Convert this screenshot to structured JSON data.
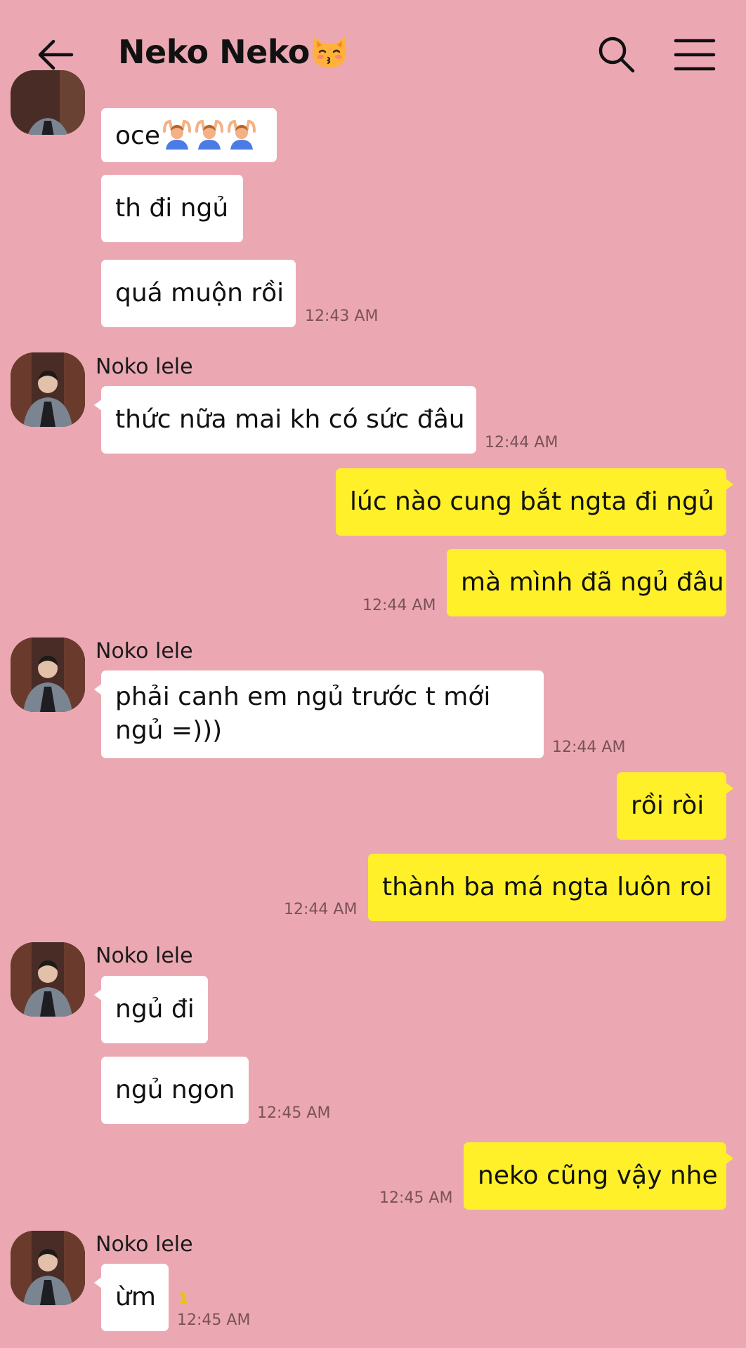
{
  "header": {
    "title": "Neko Neko",
    "title_emoji": "kissing-cat-emoji"
  },
  "contact_name": "Noko lele",
  "messages": [
    {
      "text": "oce",
      "emoji": "person-gesturing-ok x3"
    },
    {
      "text": "th đi ngủ"
    },
    {
      "text": "quá muộn rồi",
      "time": "12:43 AM"
    },
    {
      "text": "thức nữa mai kh có sức đâu",
      "time": "12:44 AM"
    },
    {
      "text": "lúc nào cung bắt ngta đi ngủ"
    },
    {
      "text": "mà mình đã ngủ đâu",
      "time": "12:44 AM"
    },
    {
      "text": "phải canh em ngủ trước t mới ngủ =)))",
      "time": "12:44 AM"
    },
    {
      "text": "rồi ròi"
    },
    {
      "text": "thành ba má ngta luôn roi",
      "time": "12:44 AM"
    },
    {
      "text": "ngủ đi"
    },
    {
      "text": "ngủ ngon",
      "time": "12:45 AM"
    },
    {
      "text": "neko cũng vậy nhe",
      "time": "12:45 AM"
    },
    {
      "text": "ừm",
      "time": "12:45 AM",
      "unread": "1"
    }
  ],
  "colors": {
    "background": "#EBA8B2",
    "incoming_bubble": "#FFFFFF",
    "outgoing_bubble": "#FFF02A",
    "timestamp": "#7a5258"
  }
}
